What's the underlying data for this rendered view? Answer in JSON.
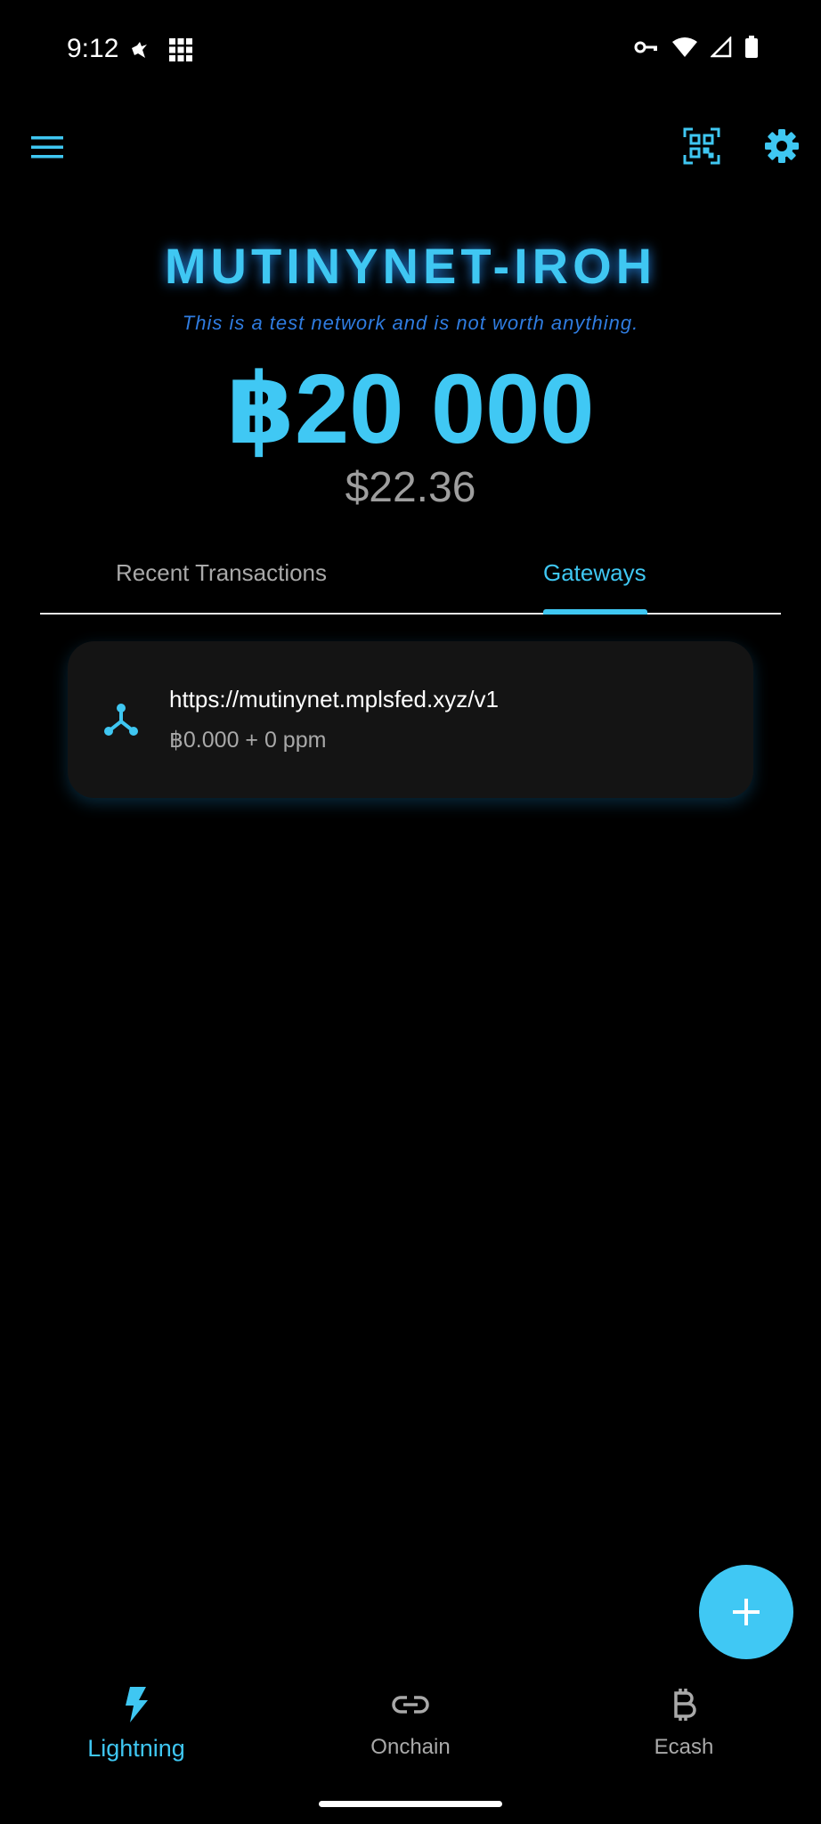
{
  "status_bar": {
    "time": "9:12"
  },
  "header": {
    "federation_name": "MUTINYNET-IROH",
    "testnet_note": "This is a test network and is not worth anything."
  },
  "balance": {
    "amount": "฿20 000",
    "fiat": "$22.36"
  },
  "tabs": [
    {
      "label": "Recent Transactions",
      "selected": false
    },
    {
      "label": "Gateways",
      "selected": true
    }
  ],
  "gateways": [
    {
      "url": "https://mutinynet.mplsfed.xyz/v1",
      "fee": "฿0.000 + 0 ppm",
      "icon": "hub-icon"
    }
  ],
  "bottom_nav": [
    {
      "label": "Lightning",
      "icon": "lightning-icon",
      "selected": true
    },
    {
      "label": "Onchain",
      "icon": "link-icon",
      "selected": false
    },
    {
      "label": "Ecash",
      "icon": "bitcoin-icon",
      "selected": false
    }
  ],
  "colors": {
    "accent": "#40c8f4",
    "background": "#000000",
    "card": "#141414",
    "muted_text": "#a9a9a9",
    "testnet_note": "#2f7ce0"
  }
}
